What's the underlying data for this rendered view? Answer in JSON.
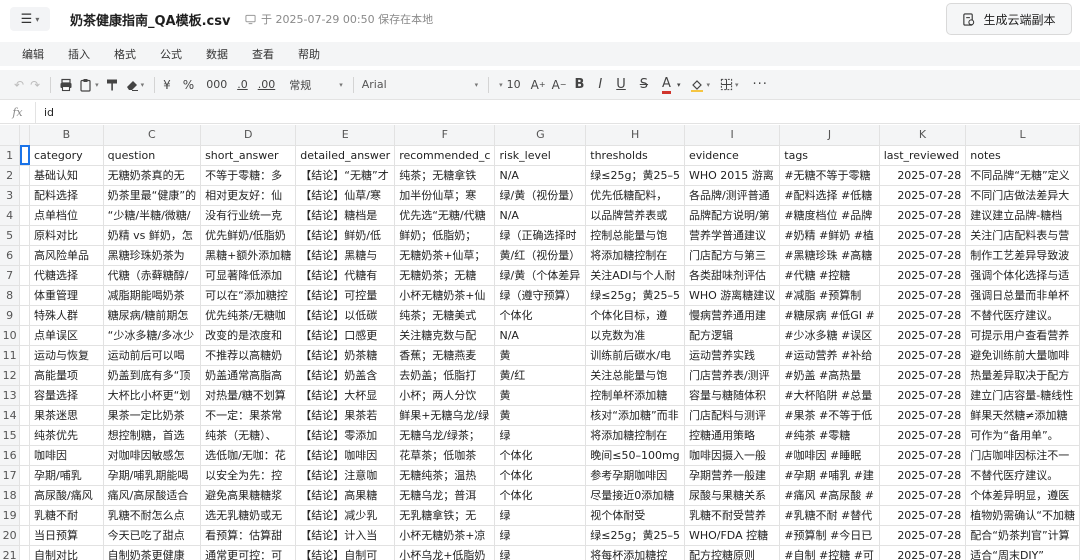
{
  "title_bar": {
    "menu_icon": "hamburger-icon",
    "doc_title": "奶茶健康指南_QA模板.csv",
    "save_status": "于 2025-07-29 00:50 保存在本地",
    "cloud_button_label": "生成云端副本"
  },
  "menu": [
    "编辑",
    "插入",
    "格式",
    "公式",
    "数据",
    "查看",
    "帮助"
  ],
  "toolbar": {
    "number_format": "常规",
    "currency": "¥",
    "percent": "%",
    "thousands": "000",
    "dec_decrease": ".0",
    "dec_increase": ".00",
    "font": "Arial",
    "font_size": "10"
  },
  "formula_bar": {
    "fx": "fx",
    "value": "id"
  },
  "columns": [
    "",
    "B",
    "C",
    "D",
    "E",
    "F",
    "G",
    "H",
    "I",
    "J",
    "K",
    "L"
  ],
  "rows": [
    {
      "n": "1",
      "cells": [
        "",
        "category",
        "question",
        "short_answer",
        "detailed_answer",
        "recommended_c",
        "risk_level",
        "thresholds",
        "evidence",
        "tags",
        "last_reviewed",
        "notes"
      ]
    },
    {
      "n": "2",
      "cells": [
        "",
        "基础认知",
        "无糖奶茶真的无",
        "不等于零糖：多",
        "【结论】“无糖”才",
        "纯茶；无糖拿铁",
        "N/A",
        "绿≤25g；黄25–5",
        "WHO 2015 游离",
        "#无糖不等于零糖",
        "2025-07-28",
        "不同品牌“无糖”定义"
      ]
    },
    {
      "n": "3",
      "cells": [
        "",
        "配料选择",
        "奶茶里最“健康”的",
        "相对更友好：仙",
        "【结论】仙草/寒",
        "加半份仙草；寒",
        "绿/黄（视份量）",
        "优先低糖配料，",
        "各品牌/测评普通",
        "#配料选择 #低糖",
        "2025-07-28",
        "不同门店做法差异大"
      ]
    },
    {
      "n": "4",
      "cells": [
        "",
        "点单档位",
        "“少糖/半糖/微糖/",
        "没有行业统一克",
        "【结论】糖档是",
        "优先选“无糖/代糖",
        "N/A",
        "以品牌营养表或",
        "品牌配方说明/第",
        "#糖度档位 #品牌",
        "2025-07-28",
        "建议建立品牌-糖档"
      ]
    },
    {
      "n": "5",
      "cells": [
        "",
        "原料对比",
        "奶精 vs 鲜奶，怎",
        "优先鲜奶/低脂奶",
        "【结论】鲜奶/低",
        "鲜奶；低脂奶；",
        "绿（正确选择时",
        "控制总能量与饱",
        "营养学普通建议",
        "#奶精 #鲜奶 #植",
        "2025-07-28",
        "关注门店配料表与营"
      ]
    },
    {
      "n": "6",
      "cells": [
        "",
        "高风险单品",
        "黑糖珍珠奶茶为",
        "黑糖+额外添加糖",
        "【结论】黑糖与",
        "无糖奶茶+仙草；",
        "黄/红（视份量）",
        "将添加糖控制在",
        "门店配方与第三",
        "#黑糖珍珠 #高糖",
        "2025-07-28",
        "制作工艺差异导致波"
      ]
    },
    {
      "n": "7",
      "cells": [
        "",
        "代糖选择",
        "代糖（赤藓糖醇/",
        "可显著降低添加",
        "【结论】代糖有",
        "无糖奶茶；无糖",
        "绿/黄（个体差异",
        "关注ADI与个人耐",
        "各类甜味剂评估",
        "#代糖 #控糖",
        "2025-07-28",
        "强调个体化选择与适"
      ]
    },
    {
      "n": "8",
      "cells": [
        "",
        "体重管理",
        "减脂期能喝奶茶",
        "可以在“添加糖控",
        "【结论】可控量",
        "小杯无糖奶茶+仙",
        "绿（遵守预算）",
        "绿≤25g；黄25–5",
        "WHO 游离糖建议",
        "#减脂 #预算制",
        "2025-07-28",
        "强调日总量而非单杯"
      ]
    },
    {
      "n": "9",
      "cells": [
        "",
        "特殊人群",
        "糖尿病/糖前期怎",
        "优先纯茶/无糖咖",
        "【结论】以低碳",
        "纯茶；无糖美式",
        "个体化",
        "个体化目标，遵",
        "慢病营养通用建",
        "#糖尿病 #低GI #",
        "2025-07-28",
        "不替代医疗建议。"
      ]
    },
    {
      "n": "10",
      "cells": [
        "",
        "点单误区",
        "“少冰多糖/多冰少",
        "改变的是浓度和",
        "【结论】口感更",
        "关注糖克数与配",
        "N/A",
        "以克数为准",
        "配方逻辑",
        "#少冰多糖 #误区",
        "2025-07-28",
        "可提示用户查看营养"
      ]
    },
    {
      "n": "11",
      "cells": [
        "",
        "运动与恢复",
        "运动前后可以喝",
        "不推荐以高糖奶",
        "【结论】奶茶糖",
        "香蕉；无糖燕麦",
        "黄",
        "训练前后碳水/电",
        "运动营养实践",
        "#运动营养 #补给",
        "2025-07-28",
        "避免训练前大量咖啡"
      ]
    },
    {
      "n": "12",
      "cells": [
        "",
        "高能量项",
        "奶盖到底有多“顶",
        "奶盖通常高脂高",
        "【结论】奶盖含",
        "去奶盖；低脂打",
        "黄/红",
        "关注总能量与饱",
        "门店营养表/测评",
        "#奶盖 #高热量",
        "2025-07-28",
        "热量差异取决于配方"
      ]
    },
    {
      "n": "13",
      "cells": [
        "",
        "容量选择",
        "大杯比小杯更“划",
        "对热量/糖不划算",
        "【结论】大杯显",
        "小杯；两人分饮",
        "黄",
        "控制单杯添加糖",
        "容量与糖随体积",
        "#大杯陷阱 #总量",
        "2025-07-28",
        "建立门店容量-糖线性"
      ]
    },
    {
      "n": "14",
      "cells": [
        "",
        "果茶迷思",
        "果茶一定比奶茶",
        "不一定：果茶常",
        "【结论】果茶若",
        "鲜果+无糖乌龙/绿",
        "黄",
        "核对“添加糖”而非",
        "门店配料与测评",
        "#果茶 #不等于低",
        "2025-07-28",
        "鲜果天然糖≠添加糖"
      ]
    },
    {
      "n": "15",
      "cells": [
        "",
        "纯茶优先",
        "想控制糖，首选",
        "纯茶（无糖）、",
        "【结论】零添加",
        "无糖乌龙/绿茶；",
        "绿",
        "将添加糖控制在",
        "控糖通用策略",
        "#纯茶 #零糖",
        "2025-07-28",
        "可作为“备用单”。"
      ]
    },
    {
      "n": "16",
      "cells": [
        "",
        "咖啡因",
        "对咖啡因敏感怎",
        "选低咖/无咖：花",
        "【结论】咖啡因",
        "花草茶；低咖茶",
        "个体化",
        "晚间≤50–100mg",
        "咖啡因摄入一般",
        "#咖啡因 #睡眠",
        "2025-07-28",
        "门店咖啡因标注不一"
      ]
    },
    {
      "n": "17",
      "cells": [
        "",
        "孕期/哺乳",
        "孕期/哺乳期能喝",
        "以安全为先：控",
        "【结论】注意咖",
        "无糖纯茶；温热",
        "个体化",
        "参考孕期咖啡因",
        "孕期营养一般建",
        "#孕期 #哺乳 #建",
        "2025-07-28",
        "不替代医疗建议。"
      ]
    },
    {
      "n": "18",
      "cells": [
        "",
        "高尿酸/痛风",
        "痛风/高尿酸适合",
        "避免高果糖糖浆",
        "【结论】高果糖",
        "无糖乌龙；普洱",
        "个体化",
        "尽量接近0添加糖",
        "尿酸与果糖关系",
        "#痛风 #高尿酸 #",
        "2025-07-28",
        "个体差异明显，遵医"
      ]
    },
    {
      "n": "19",
      "cells": [
        "",
        "乳糖不耐",
        "乳糖不耐怎么点",
        "选无乳糖奶或无",
        "【结论】减少乳",
        "无乳糖拿铁；无",
        "绿",
        "视个体耐受",
        "乳糖不耐受营养",
        "#乳糖不耐 #替代",
        "2025-07-28",
        "植物奶需确认“不加糖"
      ]
    },
    {
      "n": "20",
      "cells": [
        "",
        "当日预算",
        "今天已吃了甜点",
        "看预算：估算甜",
        "【结论】计入当",
        "小杯无糖奶茶+凉",
        "绿",
        "绿≤25g；黄25–5",
        "WHO/FDA 控糖",
        "#预算制 #今日已",
        "2025-07-28",
        "配合“奶茶判官”计算"
      ]
    },
    {
      "n": "21",
      "cells": [
        "",
        "自制对比",
        "自制奶茶更健康",
        "通常更可控：可",
        "【结论】自制可",
        "小杯乌龙+低脂奶",
        "绿",
        "将每杯添加糖控",
        "配方控糖原则",
        "#自制 #控糖 #可",
        "2025-07-28",
        "适合“周末DIY”"
      ]
    }
  ]
}
